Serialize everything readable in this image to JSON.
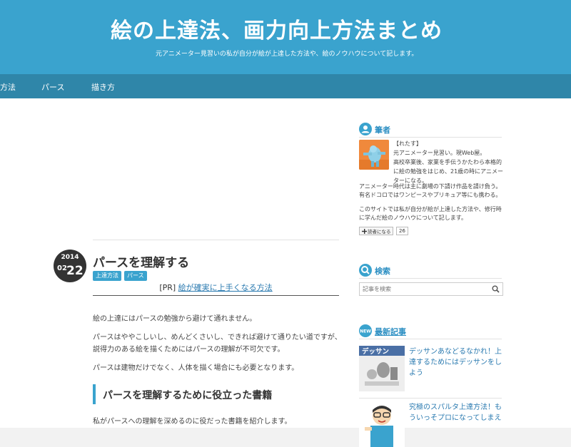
{
  "site": {
    "title": "絵の上達法、画力向上方法まとめ",
    "description": "元アニメーター見習いの私が自分が絵が上達した方法や、絵のノウハウについて記します。"
  },
  "nav": {
    "items": [
      "方法",
      "パース",
      "描き方"
    ]
  },
  "post": {
    "date_year": "2014",
    "date_month": "02",
    "date_day": "22",
    "title": "パースを理解する",
    "tags": [
      "上達方法",
      "パース"
    ],
    "pr_label": "[PR]",
    "pr_link": "絵が確実に上手くなる方法",
    "paragraphs": [
      "絵の上達にはパースの勉強から避けて通れません。",
      "パースはややこしいし、めんどくさいし、できれば避けて通りたい道ですが、",
      "説得力のある絵を描くためにはパースの理解が不可欠です。",
      "パースは建物だけでなく、人体を描く場合にも必要となります。"
    ],
    "heading": "パースを理解するために役立った書籍",
    "paragraph_after": "私がパースへの理解を深めるのに役だった書籍を紹介します。"
  },
  "sidebar": {
    "author": {
      "title": "筆者",
      "lines": [
        "【れたす】",
        "元アニメーター見習い。現Web屋。",
        "高校卒業後、家業を手伝うかたわら本格的",
        "に絵の勉強をはじめ、21歳の時にアニメー",
        "ターになる。",
        "アニメーター時代は主に劇場の下請け作品を請け負う。",
        "有名ドコロではワンピースやプリキュア等にも携わる。",
        "このサイトでは私が自分が絵が上達した方法や、修行時",
        "に学んだ絵のノウハウについて記します。"
      ],
      "like_label": "読者になる",
      "like_count": "26"
    },
    "search": {
      "title": "検索",
      "placeholder": "記事を検索"
    },
    "recent": {
      "badge": "NEW",
      "title": "最新記事",
      "thumb_label": "デッサン",
      "posts": [
        "デッサンあなどるなかれ！上達するためにはデッサンをしよう",
        "究極のスパルタ上達方法！もういっそプロになってしまえ"
      ]
    }
  },
  "colors": {
    "header": "#3aa3ce",
    "nav": "#2f86a9",
    "link": "#2a7ab0"
  }
}
